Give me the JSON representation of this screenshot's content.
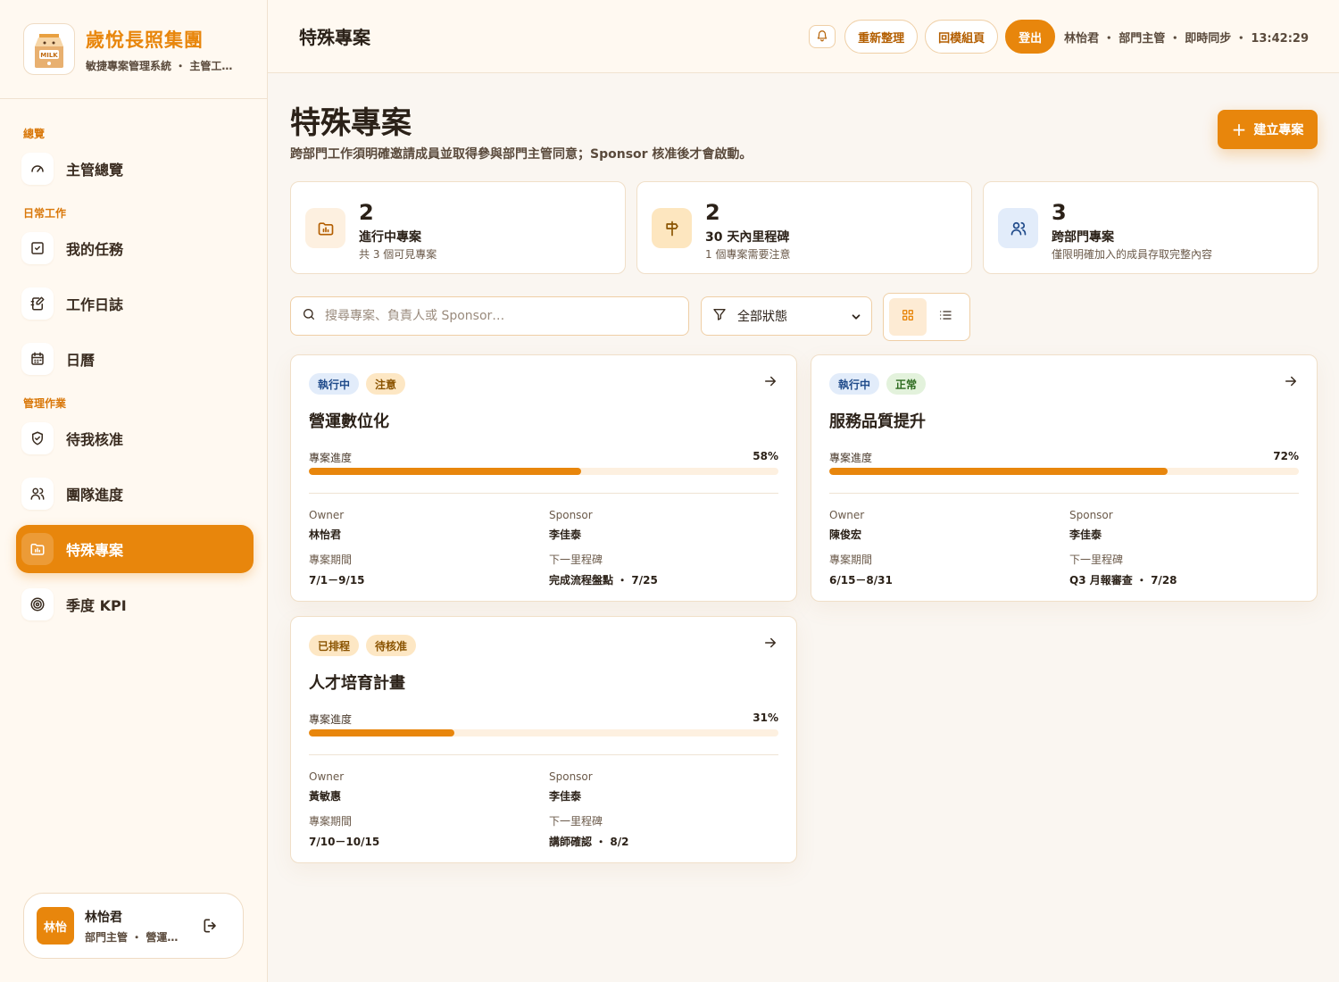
{
  "brand": {
    "name": "歲悅長照集團",
    "subtitle": "敏捷專案管理系統 ・ 主管工…"
  },
  "nav": {
    "sections": {
      "overview": "總覽",
      "daily": "日常工作",
      "manage": "管理作業"
    },
    "items": {
      "dashboard": "主管總覽",
      "tasks": "我的任務",
      "journal": "工作日誌",
      "calendar": "日曆",
      "approvals": "待我核准",
      "team": "團隊進度",
      "special": "特殊專案",
      "kpi": "季度 KPI"
    },
    "active": "special"
  },
  "user": {
    "avatar": "林怡",
    "name": "林怡君",
    "role": "部門主管 ・ 營運…"
  },
  "topbar": {
    "title": "特殊專案",
    "refresh": "重新整理",
    "back_to_module": "回模組頁",
    "logout": "登出",
    "status": "林怡君 ・ 部門主管 ・ 即時同步 ・ 13:42:29"
  },
  "page": {
    "title": "特殊專案",
    "description": "跨部門工作須明確邀請成員並取得參與部門主管同意；Sponsor 核准後才會啟動。",
    "create_button": "建立專案"
  },
  "stats": [
    {
      "value": "2",
      "label": "進行中專案",
      "sub": "共 3 個可見專案",
      "icon": "folder-icon",
      "bg": "#fdf0e0"
    },
    {
      "value": "2",
      "label": "30 天內里程碑",
      "sub": "1 個專案需要注意",
      "icon": "signpost-icon",
      "bg": "#fde6bf"
    },
    {
      "value": "3",
      "label": "跨部門專案",
      "sub": "僅限明確加入的成員存取完整內容",
      "icon": "users-icon",
      "bg": "#e2ecfa"
    }
  ],
  "toolbar": {
    "search_placeholder": "搜尋專案、負責人或 Sponsor…",
    "filter_value": "全部狀態"
  },
  "labels": {
    "progress": "專案進度",
    "owner": "Owner",
    "sponsor": "Sponsor",
    "period": "專案期間",
    "next_milestone": "下一里程碑"
  },
  "projects": [
    {
      "tags": [
        {
          "text": "執行中",
          "color": "blue"
        },
        {
          "text": "注意",
          "color": "amber"
        }
      ],
      "title": "營運數位化",
      "progress": 58,
      "progress_text": "58%",
      "owner": "林怡君",
      "sponsor": "李佳泰",
      "period": "7/1－9/15",
      "milestone": "完成流程盤點 ・ 7/25"
    },
    {
      "tags": [
        {
          "text": "執行中",
          "color": "blue"
        },
        {
          "text": "正常",
          "color": "green"
        }
      ],
      "title": "服務品質提升",
      "progress": 72,
      "progress_text": "72%",
      "owner": "陳俊宏",
      "sponsor": "李佳泰",
      "period": "6/15－8/31",
      "milestone": "Q3 月報審查 ・ 7/28"
    },
    {
      "tags": [
        {
          "text": "已排程",
          "color": "amber"
        },
        {
          "text": "待核准",
          "color": "amber"
        }
      ],
      "title": "人才培育計畫",
      "progress": 31,
      "progress_text": "31%",
      "owner": "黃敏惠",
      "sponsor": "李佳泰",
      "period": "7/10－10/15",
      "milestone": "講師確認 ・ 8/2"
    }
  ],
  "colors": {
    "accent": "#e8860c",
    "background": "#faf6f1"
  }
}
